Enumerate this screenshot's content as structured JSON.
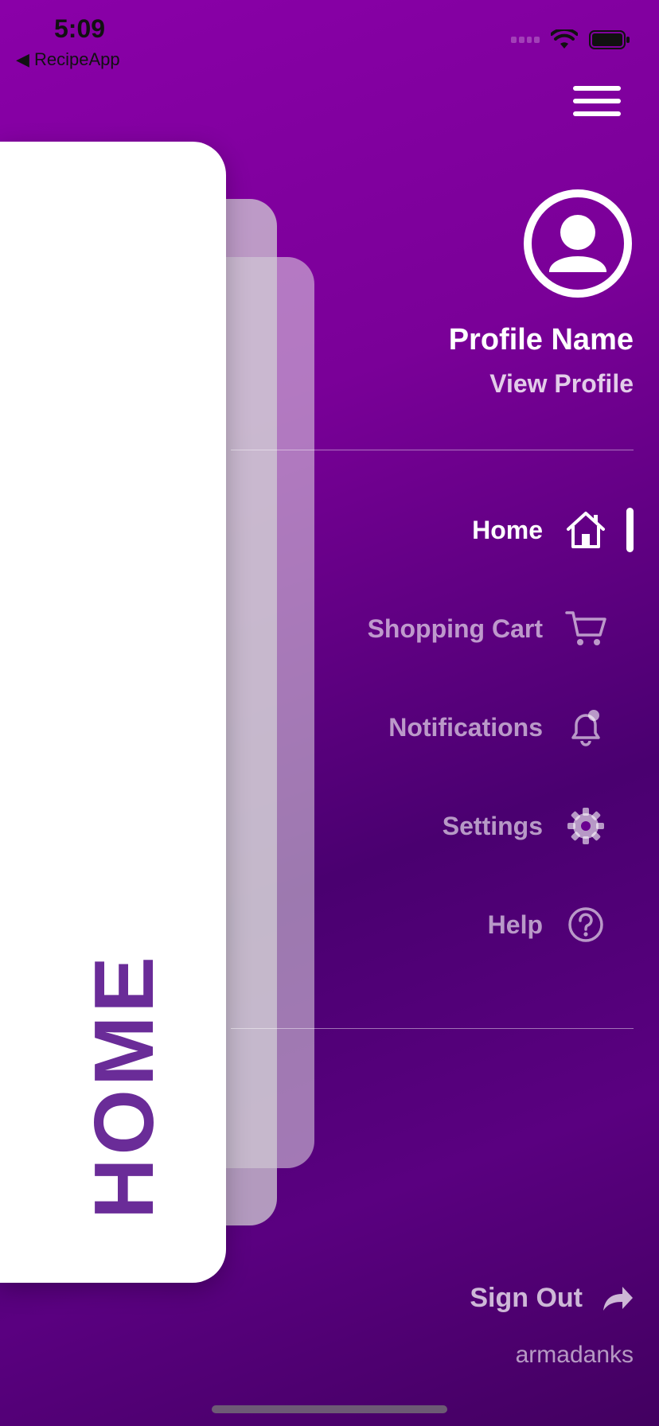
{
  "status_bar": {
    "time": "5:09",
    "back_app": "◀ RecipeApp"
  },
  "content_card": {
    "title": "HOME"
  },
  "profile": {
    "name": "Profile Name",
    "link": "View Profile"
  },
  "nav": {
    "items": [
      {
        "label": "Home",
        "icon": "home-icon",
        "active": true
      },
      {
        "label": "Shopping Cart",
        "icon": "cart-icon",
        "active": false
      },
      {
        "label": "Notifications",
        "icon": "bell-icon",
        "active": false
      },
      {
        "label": "Settings",
        "icon": "gear-icon",
        "active": false
      },
      {
        "label": "Help",
        "icon": "help-icon",
        "active": false
      }
    ]
  },
  "footer": {
    "sign_out": "Sign Out",
    "username": "armadanks"
  },
  "colors": {
    "accent": "#8a00a8",
    "card_text": "#6a2c98",
    "active": "#ffffff",
    "inactive": "rgba(255,255,255,0.6)"
  }
}
